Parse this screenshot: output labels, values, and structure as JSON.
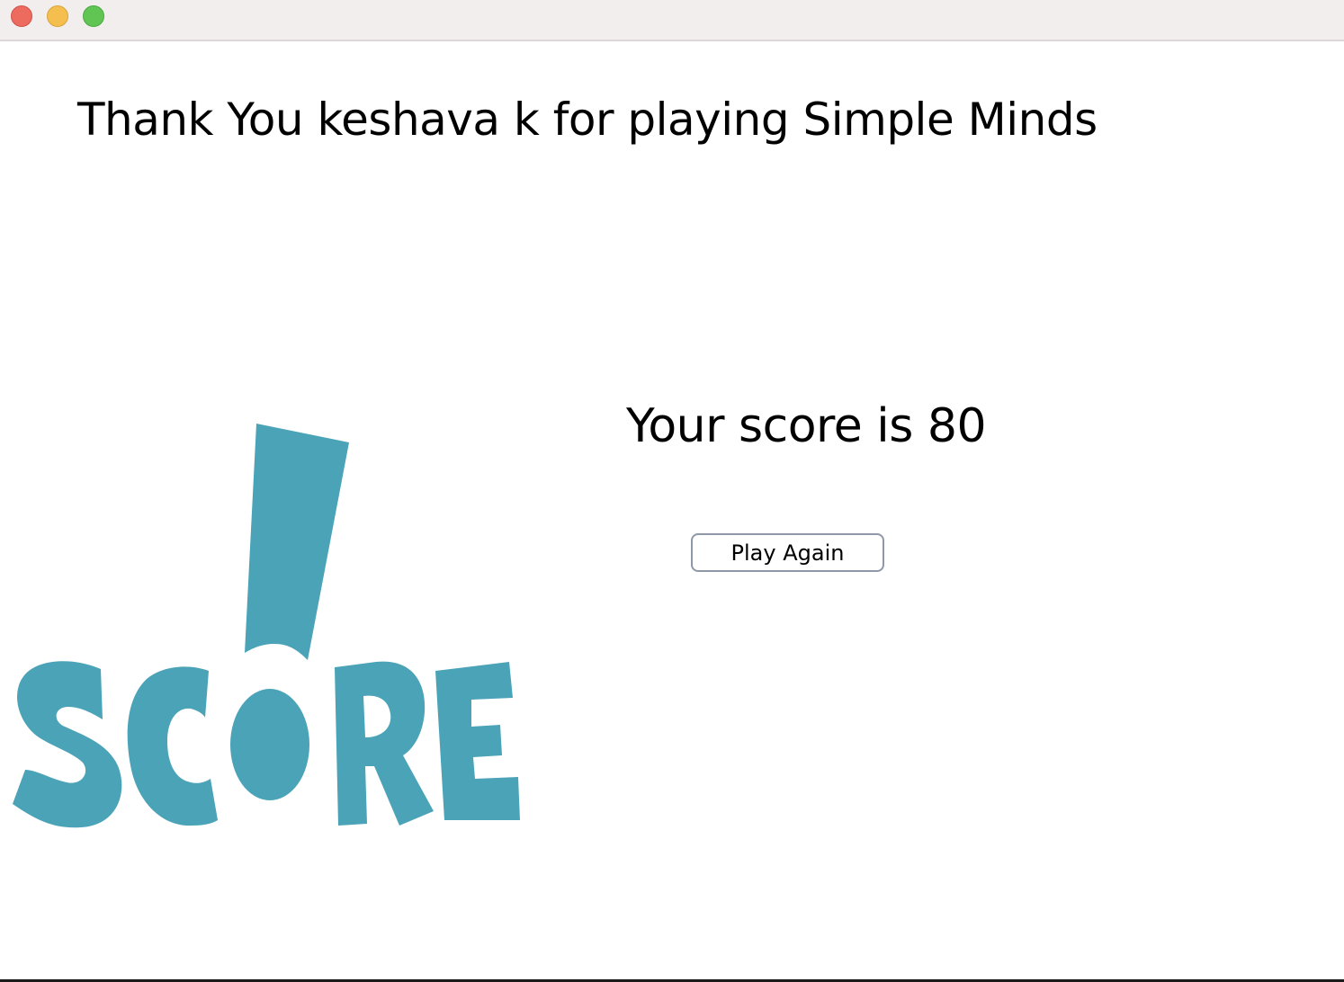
{
  "window": {
    "controls": [
      "close",
      "minimize",
      "zoom"
    ],
    "colors": {
      "close": "#ec6a5e",
      "minimize": "#f4bf4f",
      "zoom": "#61c554",
      "titlebar": "#f3eeee"
    }
  },
  "main": {
    "thank_you_message": "Thank You keshava k for playing Simple Minds",
    "score_message": "Your score is 80",
    "play_again_label": "Play Again",
    "logo": {
      "text": "SCORE",
      "color": "#4ba3b8",
      "icon": "score-exclamation-logo"
    }
  }
}
